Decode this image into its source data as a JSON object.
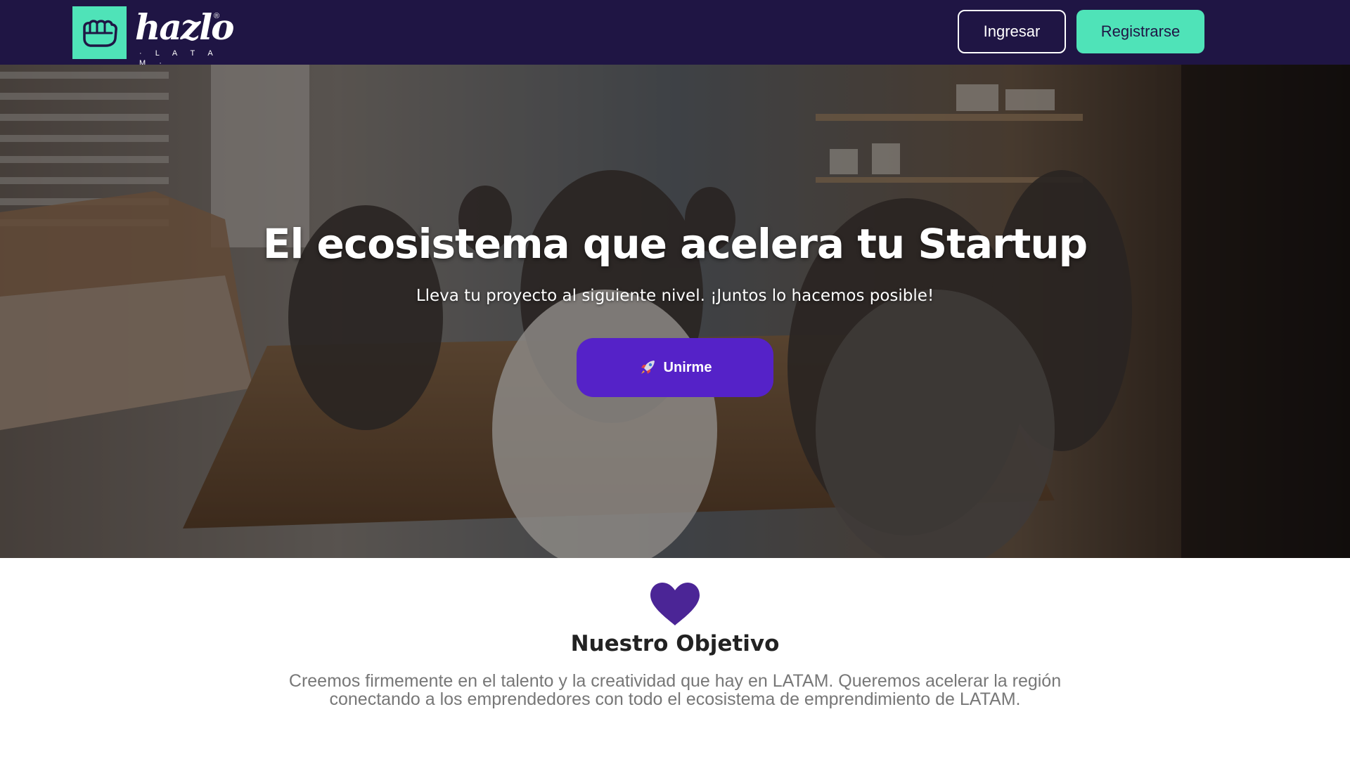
{
  "header": {
    "logo": {
      "wordmark": "hazlo",
      "registered": "®",
      "sub": "· L A T A M ·"
    },
    "login_label": "Ingresar",
    "register_label": "Registrarse"
  },
  "hero": {
    "title": "El ecosistema que acelera tu Startup",
    "subtitle": "Lleva tu proyecto al siguiente nivel. ¡Juntos lo hacemos posible!",
    "cta_label": "Unirme",
    "cta_icon": "rocket-icon"
  },
  "objective": {
    "icon": "heart-icon",
    "title": "Nuestro Objetivo",
    "text": "Creemos firmemente en el talento y la creatividad que hay en LATAM. Queremos acelerar la región conectando a los emprendedores con todo el ecosistema de emprendimiento de LATAM."
  },
  "colors": {
    "navbar": "#1f1544",
    "accent_mint": "#4fe3b8",
    "cta_purple": "#5522c8",
    "heart_purple": "#4b2596"
  }
}
